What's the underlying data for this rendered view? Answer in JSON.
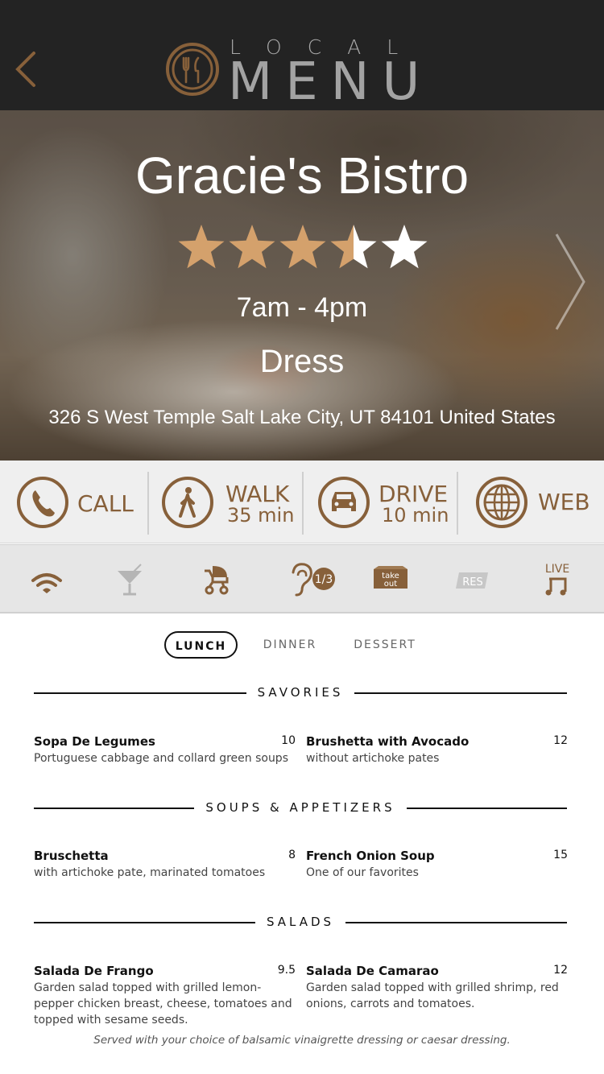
{
  "header": {
    "logo_top": "LOCAL",
    "logo_bottom": "MENU",
    "back_icon": "chevron-left-icon"
  },
  "restaurant": {
    "name": "Gracie's Bistro",
    "rating": 3.5,
    "rating_max": 5,
    "hours": "7am - 4pm",
    "dress": "Dress",
    "address": "326 S West Temple Salt Lake City, UT 84101 United States"
  },
  "actions": [
    {
      "label": "CALL",
      "sub": "",
      "icon": "phone-icon"
    },
    {
      "label": "WALK",
      "sub": "35 min",
      "icon": "walk-icon"
    },
    {
      "label": "DRIVE",
      "sub": "10 min",
      "icon": "car-icon"
    },
    {
      "label": "WEB",
      "sub": "",
      "icon": "globe-icon"
    }
  ],
  "amenities": [
    {
      "icon": "wifi-icon",
      "active": true
    },
    {
      "icon": "cocktail-icon",
      "active": false
    },
    {
      "icon": "stroller-icon",
      "active": true
    },
    {
      "icon": "hearing-icon",
      "active": true,
      "badge": "1/3"
    },
    {
      "icon": "takeout-icon",
      "active": true,
      "label": "take out"
    },
    {
      "icon": "reservation-icon",
      "active": false,
      "label": "RES"
    },
    {
      "icon": "live-music-icon",
      "active": true,
      "label": "LIVE"
    }
  ],
  "menu": {
    "tabs": [
      "LUNCH",
      "DINNER",
      "DESSERT"
    ],
    "active_tab": "LUNCH",
    "sections": [
      {
        "title": "SAVORIES",
        "items": [
          {
            "name": "Sopa De Legumes",
            "price": "10",
            "desc": "Portuguese cabbage and collard green soups"
          },
          {
            "name": "Brushetta with Avocado",
            "price": "12",
            "desc": "without artichoke pates"
          }
        ]
      },
      {
        "title": "SOUPS & APPETIZERS",
        "items": [
          {
            "name": "Bruschetta",
            "price": "8",
            "desc": "with artichoke pate, marinated tomatoes"
          },
          {
            "name": "French Onion Soup",
            "price": "15",
            "desc": "One of our favorites"
          }
        ]
      },
      {
        "title": "SALADS",
        "items": [
          {
            "name": "Salada De Frango",
            "price": "9.5",
            "desc": "Garden salad topped with grilled lemon-pepper chicken breast, cheese, tomatoes and topped with sesame seeds."
          },
          {
            "name": "Salada De Camarao",
            "price": "12",
            "desc": "Garden salad topped with grilled shrimp, red onions, carrots and tomatoes."
          }
        ]
      }
    ],
    "footnote": "Served with your choice of balsamic vinaigrette dressing or caesar dressing."
  },
  "colors": {
    "brand": "#87603a",
    "star": "#d4a16c",
    "header_bg": "#232323"
  }
}
